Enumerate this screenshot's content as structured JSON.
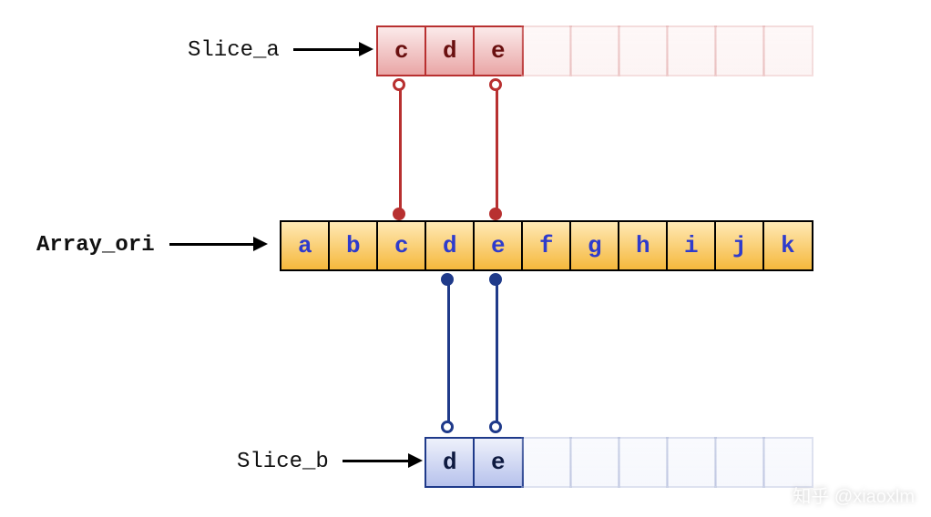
{
  "labels": {
    "slice_a": "Slice_a",
    "array_ori": "Array_ori",
    "slice_b": "Slice_b"
  },
  "slice_a": {
    "cells": [
      "c",
      "d",
      "e"
    ],
    "capacity_extra": 6
  },
  "array_ori": {
    "cells": [
      "a",
      "b",
      "c",
      "d",
      "e",
      "f",
      "g",
      "h",
      "i",
      "j",
      "k"
    ]
  },
  "slice_b": {
    "cells": [
      "d",
      "e"
    ],
    "capacity_extra": 6
  },
  "connectors": {
    "slice_a_to_ori": {
      "from_index_in_slice": 0,
      "to_index_in_ori": 2,
      "span_end_slice": 2,
      "span_end_ori": 4
    },
    "slice_b_to_ori": {
      "from_index_in_slice": 0,
      "to_index_in_ori": 3,
      "span_end_slice": 1,
      "span_end_ori": 4
    }
  },
  "watermark": "知乎 @xiaoxlm",
  "chart_data": {
    "type": "table",
    "title": "Go slice header diagram",
    "entities": [
      {
        "name": "Array_ori",
        "kind": "backing_array",
        "values": [
          "a",
          "b",
          "c",
          "d",
          "e",
          "f",
          "g",
          "h",
          "i",
          "j",
          "k"
        ]
      },
      {
        "name": "Slice_a",
        "kind": "slice",
        "points_to": "Array_ori",
        "start_index": 2,
        "len": 3,
        "cap": 9,
        "visible_values": [
          "c",
          "d",
          "e"
        ]
      },
      {
        "name": "Slice_b",
        "kind": "slice",
        "points_to": "Array_ori",
        "start_index": 3,
        "len": 2,
        "cap": 8,
        "visible_values": [
          "d",
          "e"
        ]
      }
    ]
  }
}
